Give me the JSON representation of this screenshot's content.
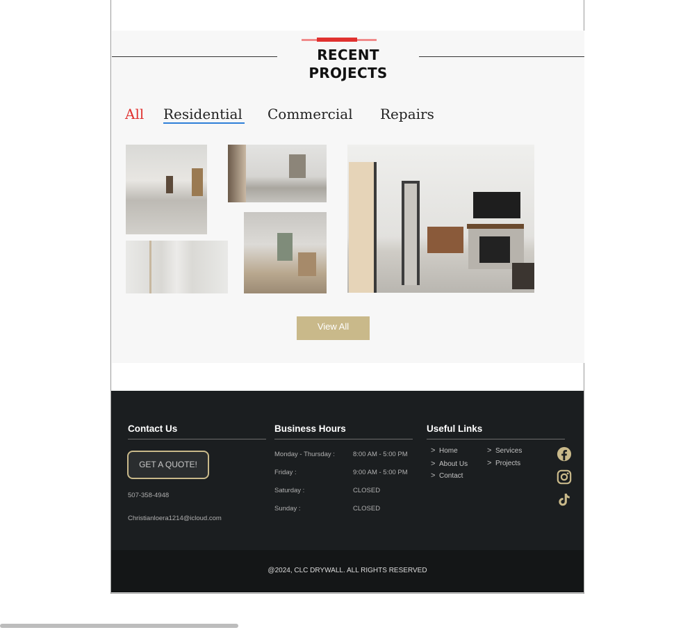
{
  "projects": {
    "heading": "RECENT PROJECTS",
    "filters": [
      "All",
      "Residential",
      "Commercial",
      "Repairs"
    ],
    "view_all_label": "View All"
  },
  "footer": {
    "contact": {
      "title": "Contact Us",
      "quote_label": "GET A QUOTE!",
      "phone": "507-358-4948",
      "email": "Christianloera1214@icloud.com"
    },
    "hours": {
      "title": "Business Hours",
      "rows": [
        {
          "day": "Monday - Thursday :",
          "time": "8:00 AM - 5:00 PM"
        },
        {
          "day": "Friday :",
          "time": "9:00 AM - 5:00 PM"
        },
        {
          "day": "Saturday :",
          "time": "CLOSED"
        },
        {
          "day": "Sunday :",
          "time": "CLOSED"
        }
      ]
    },
    "links": {
      "title": "Useful Links",
      "items": [
        "Home",
        "About Us",
        "Contact",
        "Services",
        "Projects"
      ]
    },
    "social_icons": [
      "facebook-icon",
      "instagram-icon",
      "tiktok-icon"
    ],
    "copyright": "@2024, CLC DRYWALL. ALL RIGHTS RESERVED"
  },
  "colors": {
    "accent_red": "#e0312f",
    "gold": "#c9b98a",
    "footer_bg": "#1b1e20",
    "underline_blue": "#2e7fd8"
  }
}
